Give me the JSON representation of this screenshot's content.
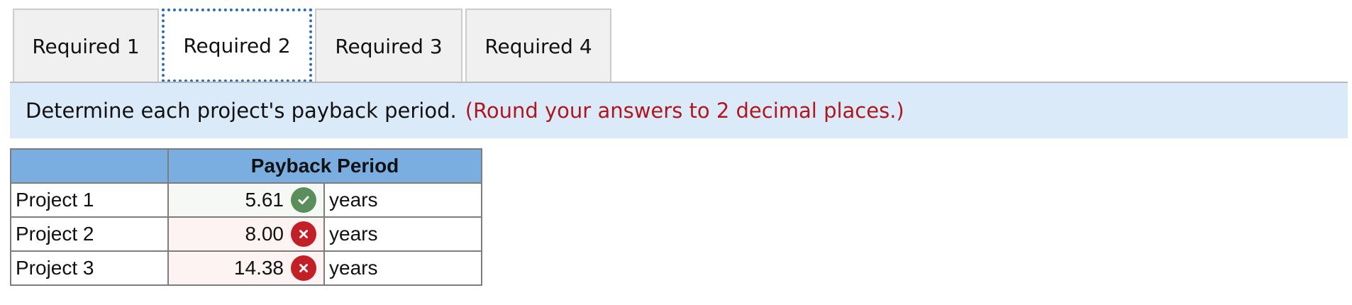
{
  "tabs": [
    {
      "label": "Required 1",
      "active": false
    },
    {
      "label": "Required 2",
      "active": true
    },
    {
      "label": "Required 3",
      "active": false
    },
    {
      "label": "Required 4",
      "active": false
    }
  ],
  "instruction": {
    "text": "Determine each project's payback period.",
    "note": "(Round your answers to 2 decimal places.)"
  },
  "table": {
    "header": "Payback Period",
    "rows": [
      {
        "label": "Project 1",
        "value": "5.61",
        "status": "correct",
        "unit": "years"
      },
      {
        "label": "Project 2",
        "value": "8.00",
        "status": "wrong",
        "unit": "years"
      },
      {
        "label": "Project 3",
        "value": "14.38",
        "status": "wrong",
        "unit": "years"
      }
    ]
  },
  "colors": {
    "active_tab_border": "#2c6db5",
    "instruction_bg": "#dbeaf9",
    "note_text": "#b0161e",
    "header_bg": "#7aade0",
    "correct": "#5a8f5c",
    "wrong": "#c31f26"
  },
  "icons": {
    "correct": "check-circle-icon",
    "wrong": "x-circle-icon"
  }
}
